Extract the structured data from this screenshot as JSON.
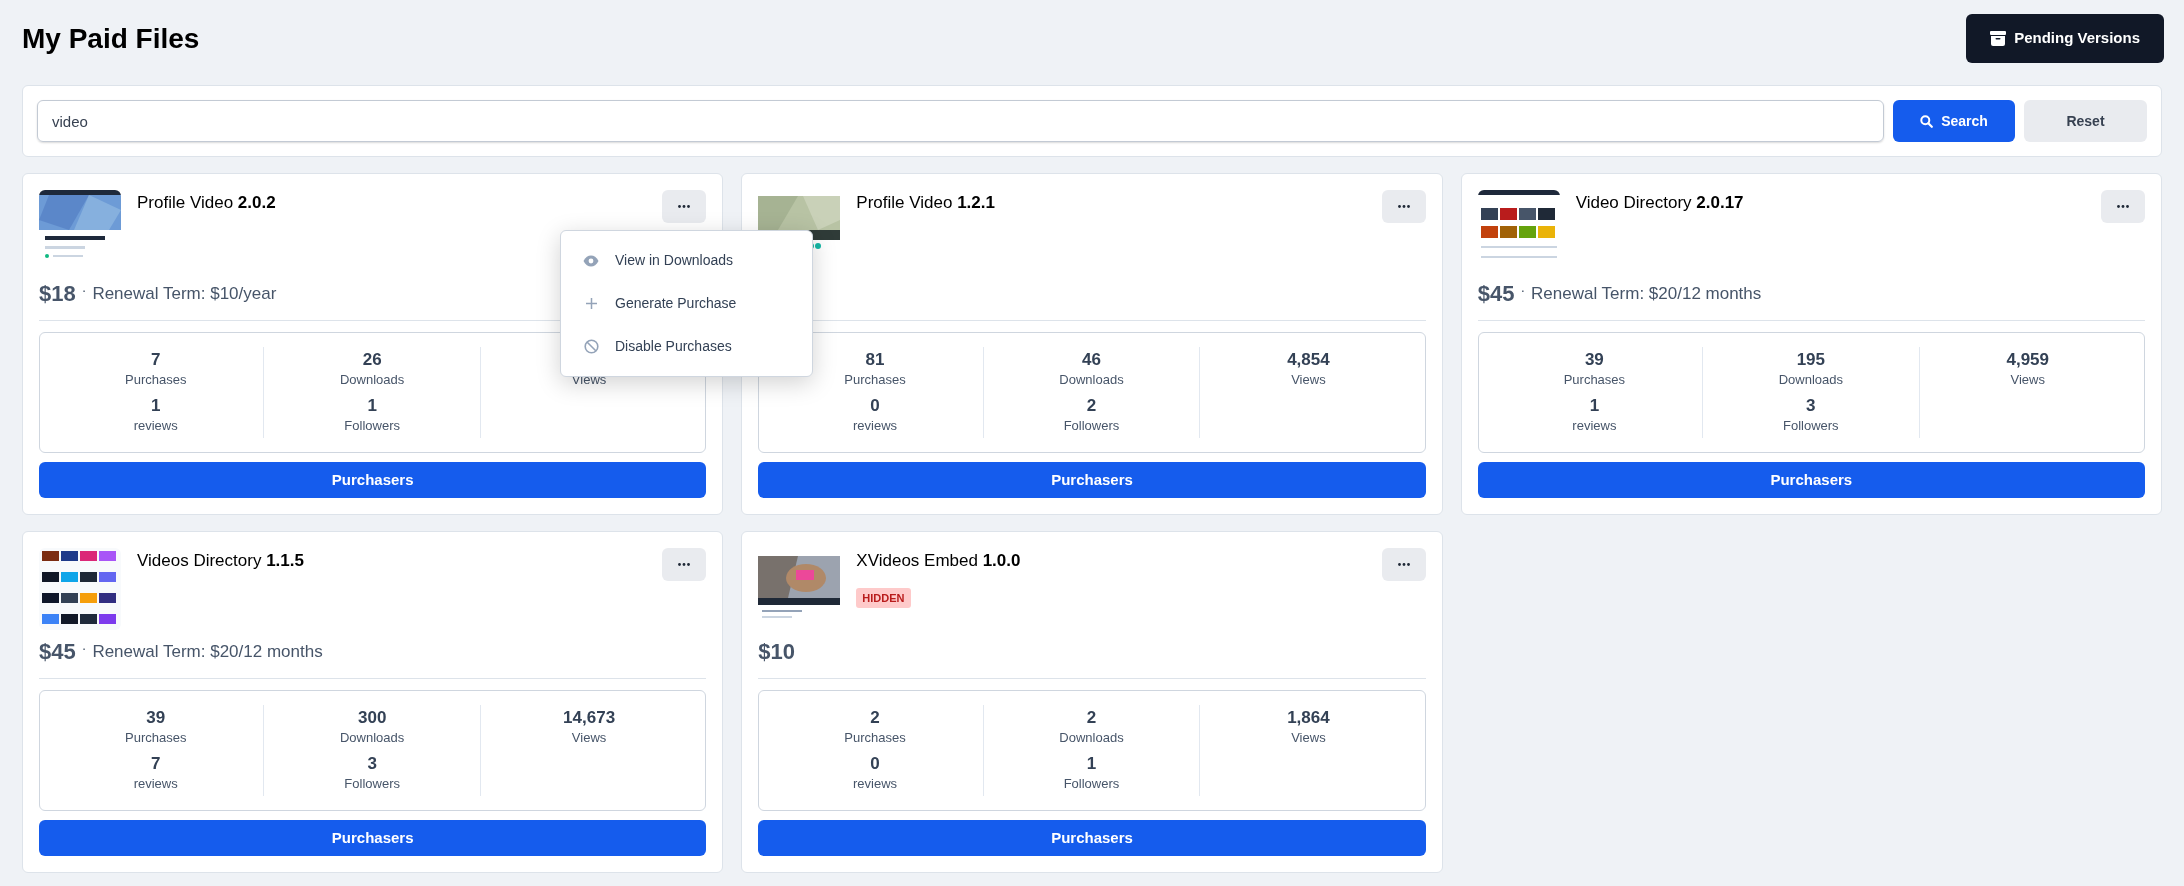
{
  "page": {
    "title": "My Paid Files"
  },
  "pending_button": {
    "label": "Pending Versions"
  },
  "search": {
    "value": "video",
    "button": "Search",
    "reset": "Reset"
  },
  "files": [
    {
      "name": "Profile Video",
      "version": "2.0.2",
      "price": "$18",
      "dot": "·",
      "renewal": "Renewal Term: $10/year",
      "menu_open": true,
      "stats": [
        {
          "value": "7",
          "label": "Purchases"
        },
        {
          "value": "26",
          "label": "Downloads"
        },
        {
          "label": "Views"
        },
        {
          "value": "1",
          "label": "reviews"
        },
        {
          "value": "1",
          "label": "Followers"
        }
      ],
      "button": "Purchasers"
    },
    {
      "name": "Profile Video",
      "version": "1.2.1",
      "menu_open": false,
      "stats": [
        {
          "value": "81",
          "label": "Purchases"
        },
        {
          "value": "46",
          "label": "Downloads"
        },
        {
          "value": "4,854",
          "label": "Views"
        },
        {
          "value": "0",
          "label": "reviews"
        },
        {
          "value": "2",
          "label": "Followers"
        }
      ],
      "button": "Purchasers"
    },
    {
      "name": "Video Directory",
      "version": "2.0.17",
      "price": "$45",
      "dot": "·",
      "renewal": "Renewal Term: $20/12 months",
      "menu_open": false,
      "stats": [
        {
          "value": "39",
          "label": "Purchases"
        },
        {
          "value": "195",
          "label": "Downloads"
        },
        {
          "value": "4,959",
          "label": "Views"
        },
        {
          "value": "1",
          "label": "reviews"
        },
        {
          "value": "3",
          "label": "Followers"
        }
      ],
      "button": "Purchasers"
    },
    {
      "name": "Videos Directory",
      "version": "1.1.5",
      "price": "$45",
      "dot": "·",
      "renewal": "Renewal Term: $20/12 months",
      "menu_open": false,
      "stats": [
        {
          "value": "39",
          "label": "Purchases"
        },
        {
          "value": "300",
          "label": "Downloads"
        },
        {
          "value": "14,673",
          "label": "Views"
        },
        {
          "value": "7",
          "label": "reviews"
        },
        {
          "value": "3",
          "label": "Followers"
        }
      ],
      "button": "Purchasers"
    },
    {
      "name": "XVideos Embed",
      "version": "1.0.0",
      "badge": "HIDDEN",
      "price": "$10",
      "menu_open": false,
      "stats": [
        {
          "value": "2",
          "label": "Purchases"
        },
        {
          "value": "2",
          "label": "Downloads"
        },
        {
          "value": "1,864",
          "label": "Views"
        },
        {
          "value": "0",
          "label": "reviews"
        },
        {
          "value": "1",
          "label": "Followers"
        }
      ],
      "button": "Purchasers"
    }
  ],
  "menu": {
    "items": [
      {
        "label": "View in Downloads"
      },
      {
        "label": "Generate Purchase"
      },
      {
        "label": "Disable Purchases"
      }
    ]
  }
}
